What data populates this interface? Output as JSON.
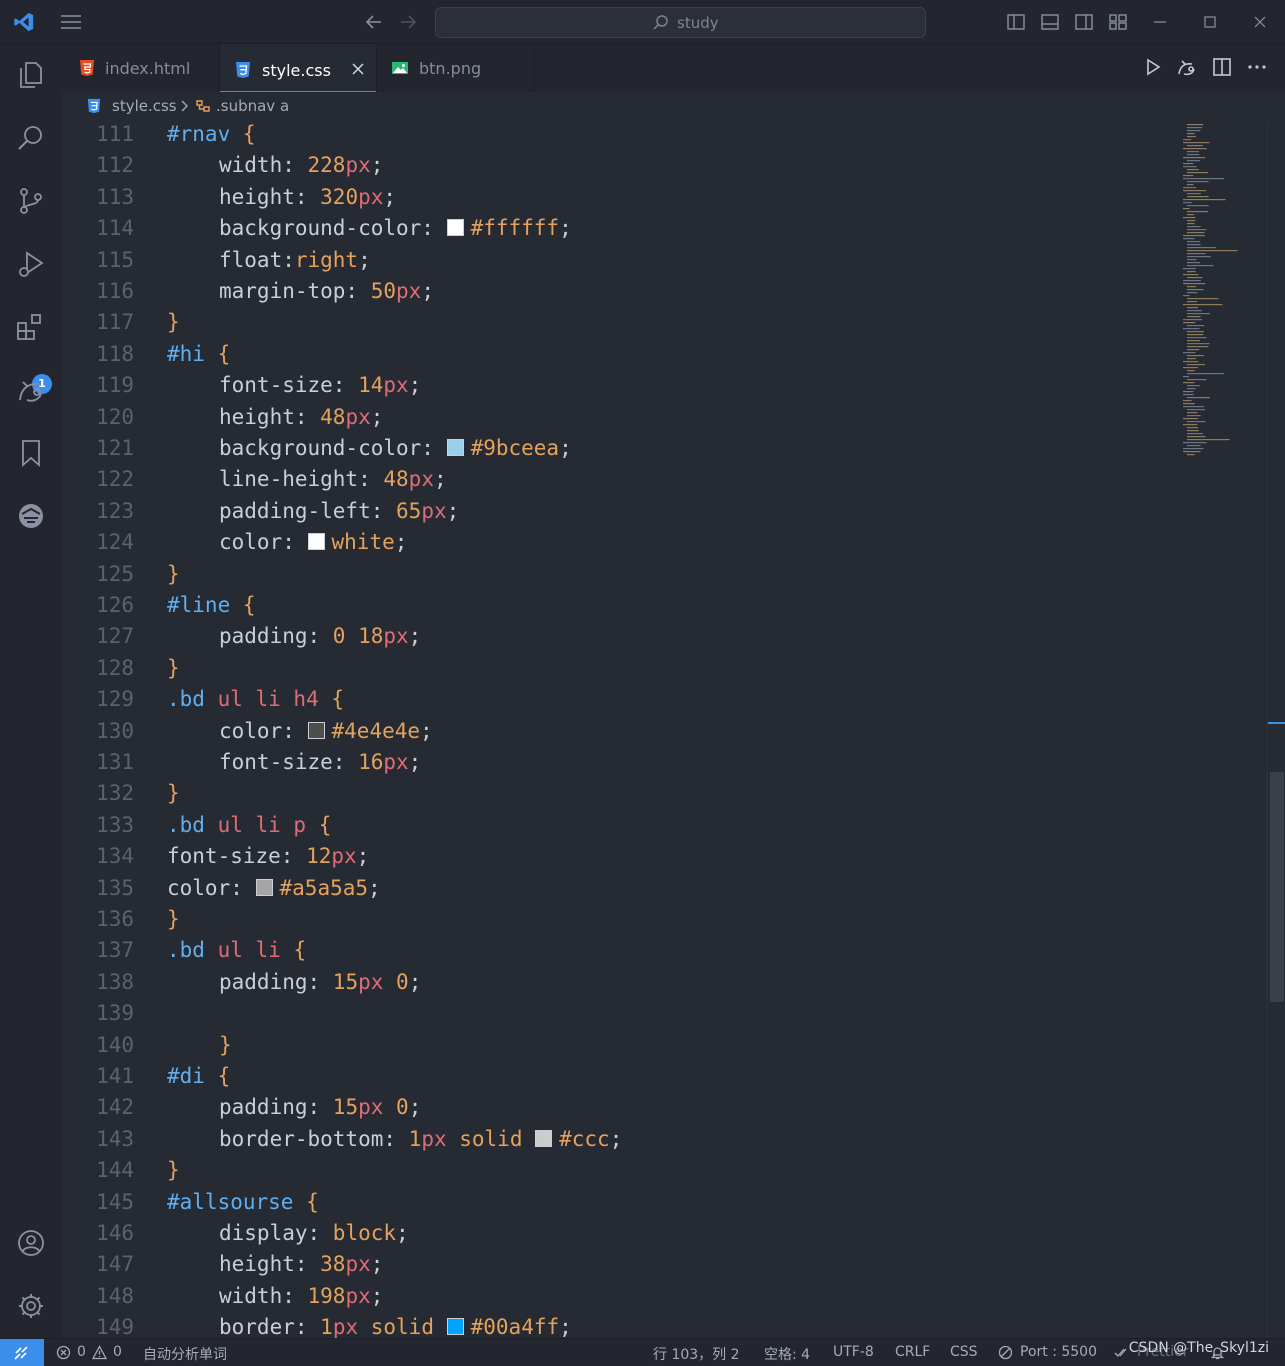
{
  "colors": {
    "accent": "#3b8eea",
    "selector": "#61afef",
    "tag": "#e06c75",
    "number": "#e5a25c"
  },
  "titlebar": {
    "search_text": "study"
  },
  "activity": {
    "extensions_badge": "1"
  },
  "tabs": [
    {
      "label": "index.html",
      "icon": "html-file-icon"
    },
    {
      "label": "style.css",
      "icon": "css-file-icon"
    },
    {
      "label": "btn.png",
      "icon": "image-file-icon"
    }
  ],
  "breadcrumb": {
    "file": "style.css",
    "symbol": ".subnav a"
  },
  "editor": {
    "lines": [
      {
        "n": "111",
        "tokens": [
          {
            "t": "#rnav ",
            "c": "sel"
          },
          {
            "t": "{",
            "c": "brace"
          }
        ]
      },
      {
        "n": "112",
        "indent": true,
        "tokens": [
          {
            "t": "width: ",
            "c": "prop"
          },
          {
            "t": "228",
            "c": "num"
          },
          {
            "t": "px",
            "c": "unit"
          },
          {
            "t": ";",
            "c": "pun"
          }
        ]
      },
      {
        "n": "113",
        "indent": true,
        "tokens": [
          {
            "t": "height: ",
            "c": "prop"
          },
          {
            "t": "320",
            "c": "num"
          },
          {
            "t": "px",
            "c": "unit"
          },
          {
            "t": ";",
            "c": "pun"
          }
        ]
      },
      {
        "n": "114",
        "indent": true,
        "tokens": [
          {
            "t": "background-color: ",
            "c": "prop"
          },
          {
            "swatch": "#ffffff"
          },
          {
            "t": "#ffffff",
            "c": "num"
          },
          {
            "t": ";",
            "c": "pun"
          }
        ]
      },
      {
        "n": "115",
        "indent": true,
        "tokens": [
          {
            "t": "float:",
            "c": "prop"
          },
          {
            "t": "right",
            "c": "kw"
          },
          {
            "t": ";",
            "c": "pun"
          }
        ]
      },
      {
        "n": "116",
        "indent": true,
        "tokens": [
          {
            "t": "margin-top: ",
            "c": "prop"
          },
          {
            "t": "50",
            "c": "num"
          },
          {
            "t": "px",
            "c": "unit"
          },
          {
            "t": ";",
            "c": "pun"
          }
        ]
      },
      {
        "n": "117",
        "tokens": [
          {
            "t": "}",
            "c": "brace"
          }
        ]
      },
      {
        "n": "118",
        "tokens": [
          {
            "t": "#hi ",
            "c": "sel"
          },
          {
            "t": "{",
            "c": "brace"
          }
        ]
      },
      {
        "n": "119",
        "indent": true,
        "tokens": [
          {
            "t": "font-size: ",
            "c": "prop"
          },
          {
            "t": "14",
            "c": "num"
          },
          {
            "t": "px",
            "c": "unit"
          },
          {
            "t": ";",
            "c": "pun"
          }
        ]
      },
      {
        "n": "120",
        "indent": true,
        "tokens": [
          {
            "t": "height: ",
            "c": "prop"
          },
          {
            "t": "48",
            "c": "num"
          },
          {
            "t": "px",
            "c": "unit"
          },
          {
            "t": ";",
            "c": "pun"
          }
        ]
      },
      {
        "n": "121",
        "indent": true,
        "tokens": [
          {
            "t": "background-color: ",
            "c": "prop"
          },
          {
            "swatch": "#9bceea"
          },
          {
            "t": "#9bceea",
            "c": "num"
          },
          {
            "t": ";",
            "c": "pun"
          }
        ]
      },
      {
        "n": "122",
        "indent": true,
        "tokens": [
          {
            "t": "line-height: ",
            "c": "prop"
          },
          {
            "t": "48",
            "c": "num"
          },
          {
            "t": "px",
            "c": "unit"
          },
          {
            "t": ";",
            "c": "pun"
          }
        ]
      },
      {
        "n": "123",
        "indent": true,
        "tokens": [
          {
            "t": "padding-left: ",
            "c": "prop"
          },
          {
            "t": "65",
            "c": "num"
          },
          {
            "t": "px",
            "c": "unit"
          },
          {
            "t": ";",
            "c": "pun"
          }
        ]
      },
      {
        "n": "124",
        "indent": true,
        "tokens": [
          {
            "t": "color: ",
            "c": "prop"
          },
          {
            "swatch": "#ffffff"
          },
          {
            "t": "white",
            "c": "kw"
          },
          {
            "t": ";",
            "c": "pun"
          }
        ]
      },
      {
        "n": "125",
        "tokens": [
          {
            "t": "}",
            "c": "brace"
          }
        ]
      },
      {
        "n": "126",
        "tokens": [
          {
            "t": "#line ",
            "c": "sel"
          },
          {
            "t": "{",
            "c": "brace"
          }
        ]
      },
      {
        "n": "127",
        "indent": true,
        "tokens": [
          {
            "t": "padding: ",
            "c": "prop"
          },
          {
            "t": "0 18",
            "c": "num"
          },
          {
            "t": "px",
            "c": "unit"
          },
          {
            "t": ";",
            "c": "pun"
          }
        ]
      },
      {
        "n": "128",
        "tokens": [
          {
            "t": "}",
            "c": "brace"
          }
        ]
      },
      {
        "n": "129",
        "tokens": [
          {
            "t": ".bd ",
            "c": "sel"
          },
          {
            "t": "ul li h4 ",
            "c": "tag"
          },
          {
            "t": "{",
            "c": "brace"
          }
        ]
      },
      {
        "n": "130",
        "indent": true,
        "tokens": [
          {
            "t": "color: ",
            "c": "prop"
          },
          {
            "swatch": "#4e4e4e"
          },
          {
            "t": "#4e4e4e",
            "c": "num"
          },
          {
            "t": ";",
            "c": "pun"
          }
        ]
      },
      {
        "n": "131",
        "indent": true,
        "tokens": [
          {
            "t": "font-size: ",
            "c": "prop"
          },
          {
            "t": "16",
            "c": "num"
          },
          {
            "t": "px",
            "c": "unit"
          },
          {
            "t": ";",
            "c": "pun"
          }
        ]
      },
      {
        "n": "132",
        "tokens": [
          {
            "t": "}",
            "c": "brace"
          }
        ]
      },
      {
        "n": "133",
        "tokens": [
          {
            "t": ".bd ",
            "c": "sel"
          },
          {
            "t": "ul li p ",
            "c": "tag"
          },
          {
            "t": "{",
            "c": "brace"
          }
        ]
      },
      {
        "n": "134",
        "tokens": [
          {
            "t": "font-size: ",
            "c": "prop"
          },
          {
            "t": "12",
            "c": "num"
          },
          {
            "t": "px",
            "c": "unit"
          },
          {
            "t": ";",
            "c": "pun"
          }
        ]
      },
      {
        "n": "135",
        "tokens": [
          {
            "t": "color: ",
            "c": "prop"
          },
          {
            "swatch": "#a5a5a5"
          },
          {
            "t": "#a5a5a5",
            "c": "num"
          },
          {
            "t": ";",
            "c": "pun"
          }
        ]
      },
      {
        "n": "136",
        "tokens": [
          {
            "t": "}",
            "c": "brace"
          }
        ]
      },
      {
        "n": "137",
        "tokens": [
          {
            "t": ".bd ",
            "c": "sel"
          },
          {
            "t": "ul li ",
            "c": "tag"
          },
          {
            "t": "{",
            "c": "brace"
          }
        ]
      },
      {
        "n": "138",
        "indent": true,
        "tokens": [
          {
            "t": "padding: ",
            "c": "prop"
          },
          {
            "t": "15",
            "c": "num"
          },
          {
            "t": "px",
            "c": "unit"
          },
          {
            "t": " 0",
            "c": "num"
          },
          {
            "t": ";",
            "c": "pun"
          }
        ]
      },
      {
        "n": "139",
        "tokens": []
      },
      {
        "n": "140",
        "indent": true,
        "tokens": [
          {
            "t": "}",
            "c": "brace"
          }
        ]
      },
      {
        "n": "141",
        "tokens": [
          {
            "t": "#di ",
            "c": "sel"
          },
          {
            "t": "{",
            "c": "brace"
          }
        ]
      },
      {
        "n": "142",
        "indent": true,
        "tokens": [
          {
            "t": "padding: ",
            "c": "prop"
          },
          {
            "t": "15",
            "c": "num"
          },
          {
            "t": "px",
            "c": "unit"
          },
          {
            "t": " 0",
            "c": "num"
          },
          {
            "t": ";",
            "c": "pun"
          }
        ]
      },
      {
        "n": "143",
        "indent": true,
        "tokens": [
          {
            "t": "border-bottom: ",
            "c": "prop"
          },
          {
            "t": "1",
            "c": "num"
          },
          {
            "t": "px",
            "c": "unit"
          },
          {
            "t": " solid ",
            "c": "kw"
          },
          {
            "swatch": "#cccccc"
          },
          {
            "t": "#ccc",
            "c": "num"
          },
          {
            "t": ";",
            "c": "pun"
          }
        ]
      },
      {
        "n": "144",
        "tokens": [
          {
            "t": "}",
            "c": "brace"
          }
        ]
      },
      {
        "n": "145",
        "tokens": [
          {
            "t": "#allsourse ",
            "c": "sel"
          },
          {
            "t": "{",
            "c": "brace"
          }
        ]
      },
      {
        "n": "146",
        "indent": true,
        "tokens": [
          {
            "t": "display: ",
            "c": "prop"
          },
          {
            "t": "block",
            "c": "kw"
          },
          {
            "t": ";",
            "c": "pun"
          }
        ]
      },
      {
        "n": "147",
        "indent": true,
        "tokens": [
          {
            "t": "height: ",
            "c": "prop"
          },
          {
            "t": "38",
            "c": "num"
          },
          {
            "t": "px",
            "c": "unit"
          },
          {
            "t": ";",
            "c": "pun"
          }
        ]
      },
      {
        "n": "148",
        "indent": true,
        "tokens": [
          {
            "t": "width: ",
            "c": "prop"
          },
          {
            "t": "198",
            "c": "num"
          },
          {
            "t": "px",
            "c": "unit"
          },
          {
            "t": ";",
            "c": "pun"
          }
        ]
      },
      {
        "n": "149",
        "indent": true,
        "tokens": [
          {
            "t": "border: ",
            "c": "prop"
          },
          {
            "t": "1",
            "c": "num"
          },
          {
            "t": "px",
            "c": "unit"
          },
          {
            "t": " solid ",
            "c": "kw"
          },
          {
            "swatch": "#00a4ff"
          },
          {
            "t": "#00a4ff",
            "c": "num"
          },
          {
            "t": ";",
            "c": "pun"
          }
        ]
      }
    ]
  },
  "statusbar": {
    "errors": "0",
    "warnings": "0",
    "spell": "自动分析单词",
    "position": "行 103，列 2",
    "indent": "空格: 4",
    "encoding": "UTF-8",
    "eol": "CRLF",
    "language": "CSS",
    "port": "Port : 5500",
    "prettier": "Prettier",
    "watermark": "CSDN @The_Skyl1zi"
  }
}
